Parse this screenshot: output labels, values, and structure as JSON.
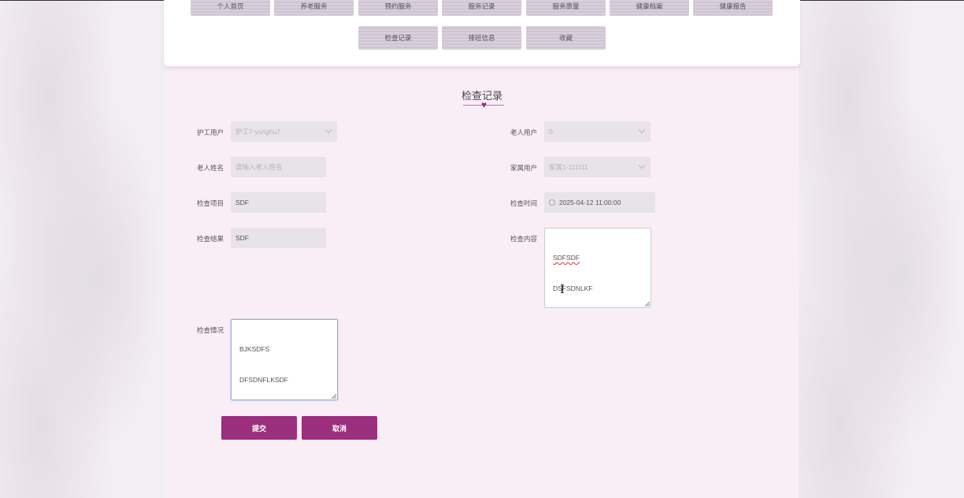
{
  "nav": {
    "row1": [
      "个人首页",
      "养老服务",
      "预约服务",
      "服务记录",
      "服务质量",
      "健康档案",
      "健康报告"
    ],
    "row2": [
      "检查记录",
      "排班信息",
      "收藏"
    ]
  },
  "page": {
    "title": "检查记录"
  },
  "form": {
    "nurse_user": {
      "label": "护工用户",
      "value": "护工7-yonghu7"
    },
    "elder_user": {
      "label": "老人用户",
      "value": "0"
    },
    "elder_name": {
      "label": "老人姓名",
      "placeholder": "请输入老人姓名"
    },
    "family_user": {
      "label": "家属用户",
      "value": "家属1-111111"
    },
    "check_item": {
      "label": "检查项目",
      "value": "SDF"
    },
    "check_time": {
      "label": "检查时间",
      "value": "2025-04-12 11:00:00"
    },
    "check_result": {
      "label": "检查结果",
      "value": "SDF"
    },
    "check_content": {
      "label": "检查内容",
      "line1": "SDFSDF",
      "line2": "DSFSDNLKF"
    },
    "check_situation": {
      "label": "检查情况",
      "line1": "BJKSDFS",
      "line2": "DFSDNFLKSDF"
    }
  },
  "buttons": {
    "submit": "提交",
    "cancel": "取消"
  },
  "colors": {
    "accent": "#9b2f7d",
    "background": "#f9eef6"
  },
  "icons": {
    "clock": "clock-icon",
    "heart": "heart-icon",
    "chevron": "chevron-down-icon",
    "cursor": "text-cursor-icon"
  }
}
